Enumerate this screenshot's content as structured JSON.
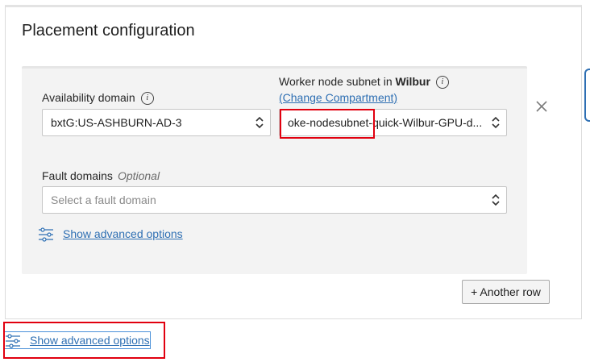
{
  "panel": {
    "title": "Placement configuration"
  },
  "availability_domain": {
    "label": "Availability domain",
    "value": "bxtG:US-ASHBURN-AD-3"
  },
  "worker_subnet": {
    "label_prefix": "Worker node subnet in",
    "compartment": "Wilbur",
    "change_link": "(Change Compartment)",
    "value": "oke-nodesubnet-quick-Wilbur-GPU-d..."
  },
  "fault_domains": {
    "label": "Fault domains",
    "optional": "Optional",
    "placeholder": "Select a fault domain"
  },
  "inner_advanced_link": "Show advanced options",
  "another_row_button": "+ Another row",
  "outer_advanced_link": "Show advanced options",
  "colors": {
    "link": "#2e6fb3",
    "highlight": "#e1000f",
    "inner_bg": "#f3f3f3"
  },
  "icons": [
    "info-icon",
    "chevron-updown-icon",
    "close-icon",
    "sliders-icon"
  ]
}
